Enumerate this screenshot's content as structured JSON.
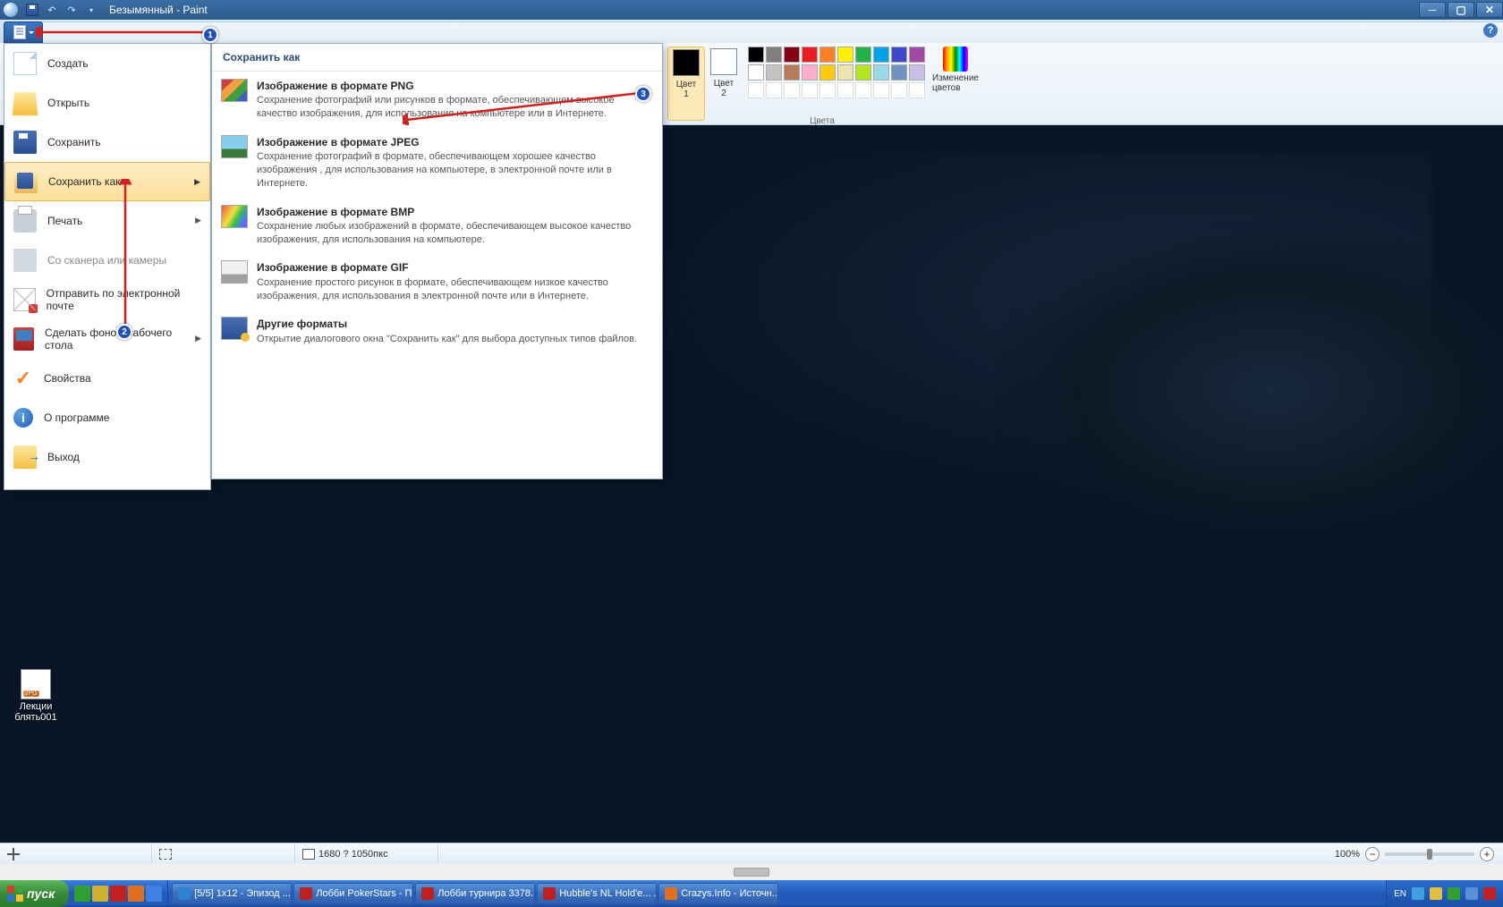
{
  "title": "Безымянный - Paint",
  "file_menu": {
    "items": [
      {
        "label": "Создать",
        "icon": "new"
      },
      {
        "label": "Открыть",
        "icon": "open"
      },
      {
        "label": "Сохранить",
        "icon": "save"
      },
      {
        "label": "Сохранить как",
        "icon": "saveas",
        "selected": true,
        "arrow": true
      },
      {
        "label": "Печать",
        "icon": "print",
        "arrow": true
      },
      {
        "label": "Со сканера или камеры",
        "icon": "scan",
        "disabled": true
      },
      {
        "label": "Отправить по электронной почте",
        "icon": "email"
      },
      {
        "label": "Сделать фоном рабочего стола",
        "icon": "wall",
        "arrow": true
      },
      {
        "label": "Свойства",
        "icon": "props"
      },
      {
        "label": "О программе",
        "icon": "about"
      },
      {
        "label": "Выход",
        "icon": "exit"
      }
    ]
  },
  "submenu": {
    "header": "Сохранить как",
    "items": [
      {
        "t": "Изображение в формате PNG",
        "d": "Сохранение фотографий или рисунков в формате, обеспечивающем высокое качество изображения, для использования на компьютере или в Интернете.",
        "thumb": "png"
      },
      {
        "t": "Изображение в формате JPEG",
        "d": "Сохранение фотографий в формате, обеспечивающем хорошее качество изображения , для использования на компьютере, в электронной почте или в Интернете.",
        "thumb": "jpeg"
      },
      {
        "t": "Изображение в формате BMP",
        "d": "Сохранение любых изображений в формате, обеспечивающем высокое качество изображения, для использования на компьютере.",
        "thumb": "bmp"
      },
      {
        "t": "Изображение в формате GIF",
        "d": "Сохранение простого рисунок в формате, обеспечивающем низкое качество изображения, для использования в электронной почте или в Интернете.",
        "thumb": "gif"
      },
      {
        "t": "Другие форматы",
        "d": "Открытие диалогового окна \"Сохранить как\" для выбора доступных типов файлов.",
        "thumb": "other"
      }
    ]
  },
  "colors": {
    "color1_label": "Цвет\n1",
    "color2_label": "Цвет\n2",
    "color1": "#000000",
    "color2": "#ffffff",
    "edit_label": "Изменение цветов",
    "group_label": "Цвета",
    "row1": [
      "#000000",
      "#7f7f7f",
      "#880015",
      "#ed1c24",
      "#ff7f27",
      "#fff200",
      "#22b14c",
      "#00a2e8",
      "#3f48cc",
      "#a349a4"
    ],
    "row2": [
      "#ffffff",
      "#c3c3c3",
      "#b97a57",
      "#ffaec9",
      "#ffc90e",
      "#efe4b0",
      "#b5e61d",
      "#99d9ea",
      "#7092be",
      "#c8bfe7"
    ],
    "row3": [
      "#ffffff",
      "#ffffff",
      "#ffffff",
      "#ffffff",
      "#ffffff",
      "#ffffff",
      "#ffffff",
      "#ffffff",
      "#ffffff",
      "#ffffff"
    ]
  },
  "status": {
    "dimensions": "1680 ? 1050пкс",
    "zoom": "100%"
  },
  "desktop_file": "Лекции блять001",
  "taskbar": {
    "start": "пуск",
    "buttons": [
      {
        "label": "[5/5] 1x12 - Эпизод ...",
        "color": "#3080d0"
      },
      {
        "label": "Лобби PokerStars - П...",
        "color": "#c02020"
      },
      {
        "label": "Лобби турнира 3378...",
        "color": "#c02020"
      },
      {
        "label": "Hubble's NL Hold'e... ...",
        "color": "#c02020"
      },
      {
        "label": "Crazys.Info - Источн...",
        "color": "#e07020"
      }
    ],
    "lang": "EN"
  },
  "annotations": {
    "b1": "1",
    "b2": "2",
    "b3": "3"
  }
}
